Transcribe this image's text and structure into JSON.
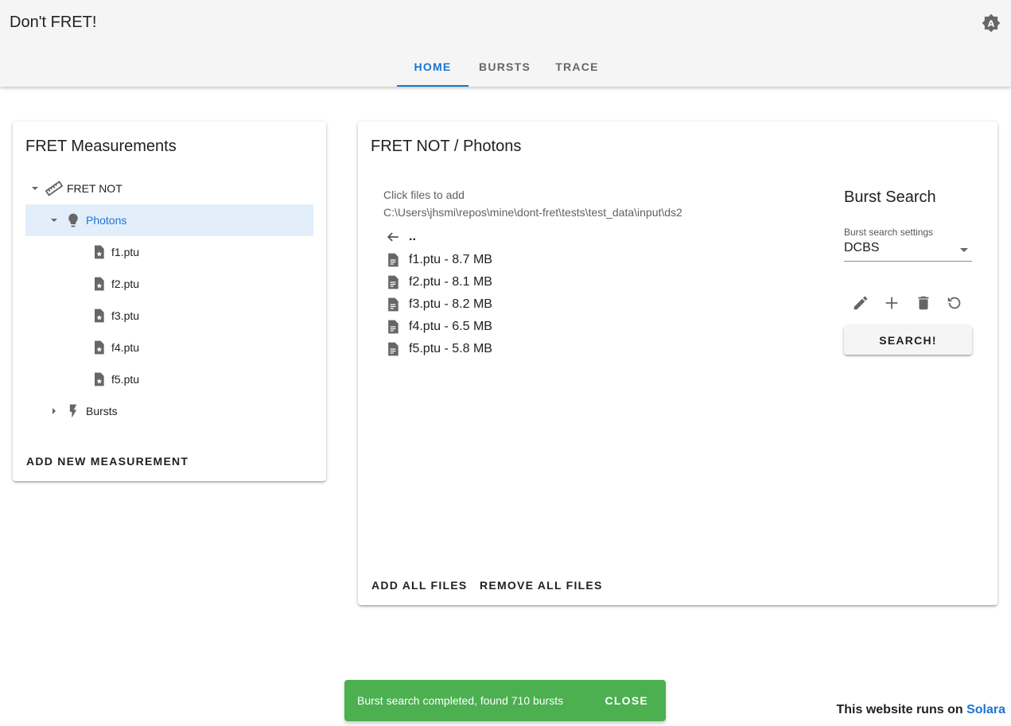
{
  "app": {
    "title": "Don't FRET!"
  },
  "tabs": [
    {
      "label": "HOME",
      "active": true
    },
    {
      "label": "BURSTS",
      "active": false
    },
    {
      "label": "TRACE",
      "active": false
    }
  ],
  "measurements": {
    "title": "FRET Measurements",
    "tree": {
      "root": "FRET NOT",
      "photons": "Photons",
      "files": [
        "f1.ptu",
        "f2.ptu",
        "f3.ptu",
        "f4.ptu",
        "f5.ptu"
      ],
      "bursts": "Bursts"
    },
    "add_label": "ADD NEW MEASUREMENT"
  },
  "photons": {
    "title": "FRET NOT / Photons",
    "hint": "Click files to add",
    "path": "C:\\Users\\jhsmi\\repos\\mine\\dont-fret\\tests\\test_data\\input\\ds2",
    "parent": "..",
    "files": [
      "f1.ptu - 8.7 MB",
      "f2.ptu - 8.1 MB",
      "f3.ptu - 8.2 MB",
      "f4.ptu - 6.5 MB",
      "f5.ptu - 5.8 MB"
    ],
    "add_all": "ADD ALL FILES",
    "remove_all": "REMOVE ALL FILES"
  },
  "burst_search": {
    "title": "Burst Search",
    "settings_label": "Burst search settings",
    "settings_value": "DCBS",
    "search_label": "SEARCH!"
  },
  "snackbar": {
    "message": "Burst search completed, found 710 bursts",
    "close": "CLOSE"
  },
  "footer": {
    "text": "This website runs on",
    "link": "Solara"
  },
  "colors": {
    "accent": "#1976d2",
    "snackbar": "#4caf50",
    "selected_bg": "#e3eefb",
    "appbar": "#f5f5f5"
  }
}
